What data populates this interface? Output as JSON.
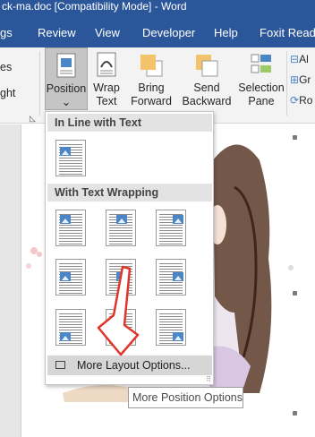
{
  "window": {
    "title": "ck-ma.doc [Compatibility Mode] - Word"
  },
  "menu": [
    "gs",
    "Review",
    "View",
    "Developer",
    "Help",
    "Foxit Reade"
  ],
  "ribbon": {
    "left_partial_1": "es",
    "left_partial_2": "ght",
    "position": {
      "label": "Position",
      "arrow": "⌄"
    },
    "wrap_text": {
      "label1": "Wrap",
      "label2": "Text"
    },
    "bring_forward": {
      "label1": "Bring",
      "label2": "Forward"
    },
    "send_backward": {
      "label1": "Send",
      "label2": "Backward"
    },
    "selection_pane": {
      "label1": "Selection",
      "label2": "Pane"
    },
    "right_partial_1": "Al",
    "right_partial_2": "Gr",
    "right_partial_3": "Ro"
  },
  "dropdown": {
    "section_inline": "In Line with Text",
    "section_wrap": "With Text Wrapping",
    "more_layout": "More Layout Options..."
  },
  "tooltip": "More Position Options",
  "colors": {
    "accent": "#2b579a",
    "arrow": "#e0352b"
  }
}
